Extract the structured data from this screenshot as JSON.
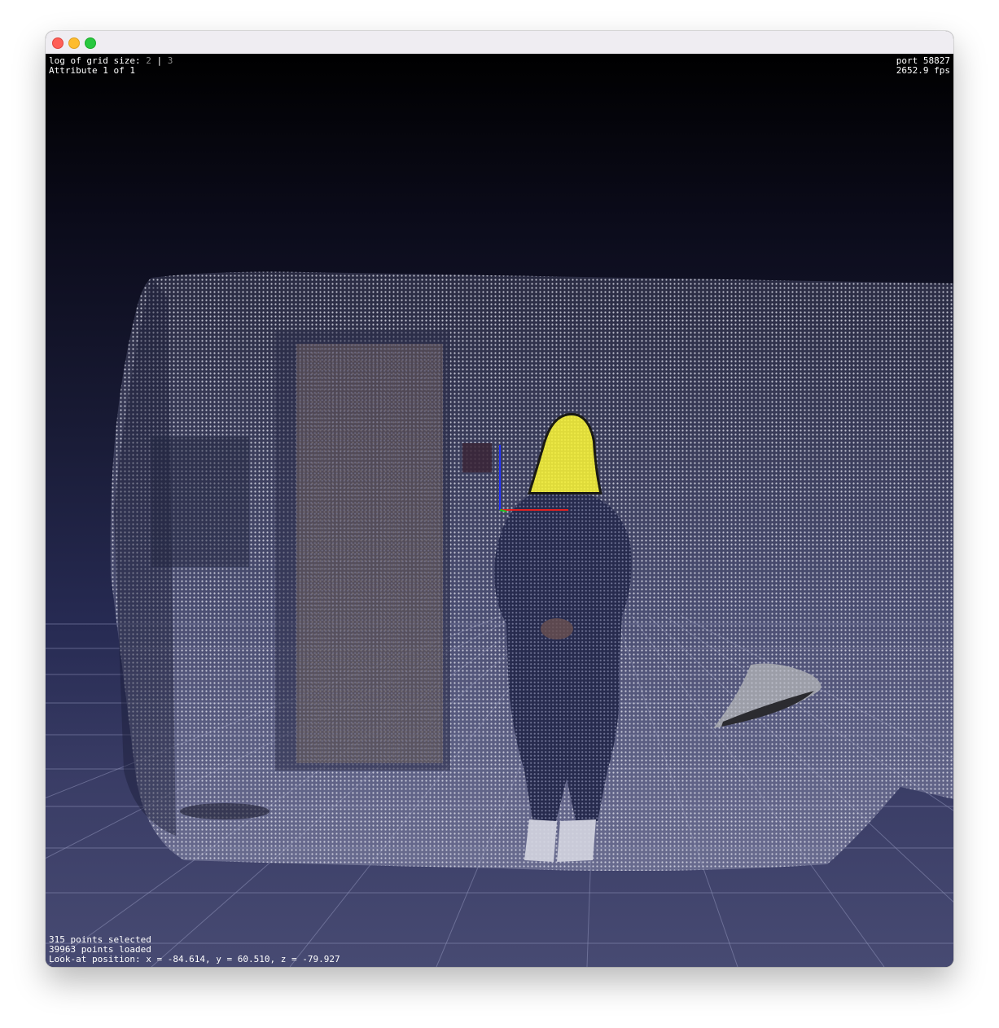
{
  "hud": {
    "grid_label": "log of grid size:",
    "grid_option_a": "2",
    "grid_separator": "|",
    "grid_option_b": "3",
    "attribute": "Attribute 1 of 1",
    "port": "port 58827",
    "fps": "2652.9 fps",
    "selected": "315 points selected",
    "loaded": "39963 points loaded",
    "look_at": "Look-at position: x = -84.614, y = 60.510, z = -79.927"
  },
  "colors": {
    "selection": "#e6e23a",
    "axis_x": "#e02020",
    "axis_y": "#20c020",
    "axis_z": "#2030ff"
  }
}
